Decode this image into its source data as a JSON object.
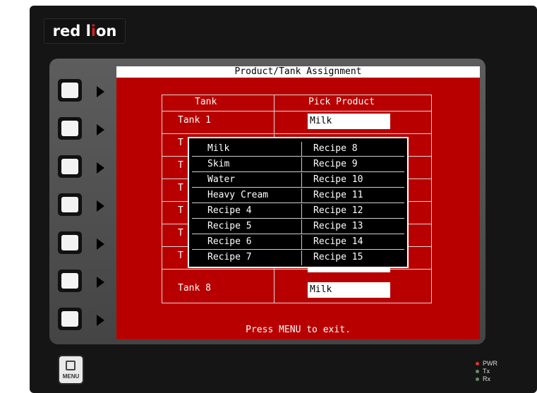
{
  "brand": {
    "text_before": "red l",
    "text_accent": "i",
    "text_after": "on"
  },
  "screen": {
    "title": "Product/Tank Assignment",
    "col_tank": "Tank",
    "col_product": "Pick Product",
    "footer": "Press MENU to exit.",
    "rows": [
      {
        "tank": "Tank 1",
        "product": "Milk"
      },
      {
        "tank": "T",
        "product": ""
      },
      {
        "tank": "T",
        "product": ""
      },
      {
        "tank": "T",
        "product": ""
      },
      {
        "tank": "T",
        "product": ""
      },
      {
        "tank": "T",
        "product": ""
      },
      {
        "tank": "T",
        "product": ""
      },
      {
        "tank": "Tank 8",
        "product": "Milk"
      }
    ]
  },
  "popup": {
    "col1": [
      "Milk",
      "Skim",
      "Water",
      "Heavy Cream",
      "Recipe 4",
      "Recipe 5",
      "Recipe 6",
      "Recipe 7"
    ],
    "col2": [
      "Recipe 8",
      "Recipe 9",
      "Recipe 10",
      "Recipe 11",
      "Recipe 12",
      "Recipe 13",
      "Recipe 14",
      "Recipe 15"
    ]
  },
  "menu_button": {
    "label": "MENU",
    "icon": "menu-icon"
  },
  "leds": [
    {
      "label": "PWR",
      "color": "#e83030"
    },
    {
      "label": "Tx",
      "color": "#6a8a6a"
    },
    {
      "label": "Rx",
      "color": "#6a8a6a"
    }
  ],
  "colors": {
    "screen_bg": "#b80000",
    "popup_bg": "#000000"
  }
}
